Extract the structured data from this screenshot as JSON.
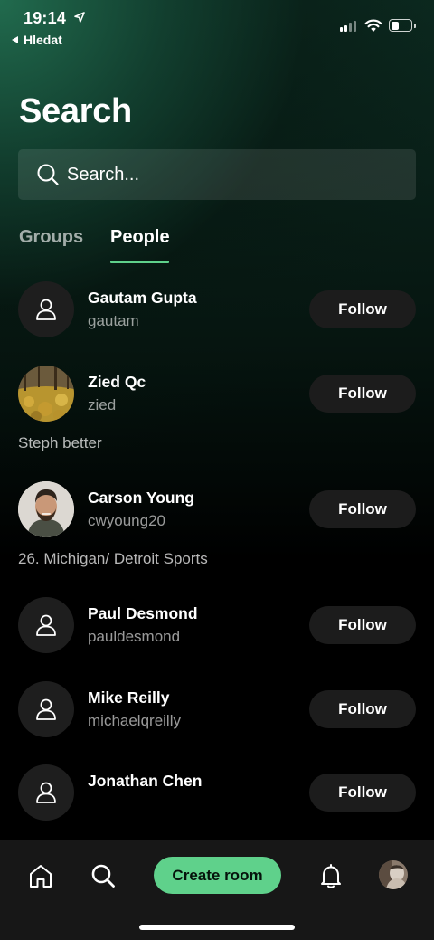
{
  "status_bar": {
    "time": "19:14",
    "back_label": "Hledat"
  },
  "page": {
    "title": "Search"
  },
  "search": {
    "placeholder": "Search..."
  },
  "tabs": [
    {
      "label": "Groups",
      "active": false
    },
    {
      "label": "People",
      "active": true
    }
  ],
  "people": [
    {
      "name": "Gautam Gupta",
      "handle": "gautam",
      "bio": "",
      "avatar": "person-icon",
      "action": "Follow"
    },
    {
      "name": "Zied Qc",
      "handle": "zied",
      "bio": "Steph better",
      "avatar": "photo-leaves",
      "action": "Follow"
    },
    {
      "name": "Carson Young",
      "handle": "cwyoung20",
      "bio": "26. Michigan/ Detroit Sports",
      "avatar": "photo-man",
      "action": "Follow"
    },
    {
      "name": "Paul Desmond",
      "handle": "pauldesmond",
      "bio": "",
      "avatar": "person-icon",
      "action": "Follow"
    },
    {
      "name": "Mike Reilly",
      "handle": "michaelqreilly",
      "bio": "",
      "avatar": "person-icon",
      "action": "Follow"
    },
    {
      "name": "Jonathan Chen",
      "handle": "",
      "bio": "",
      "avatar": "person-icon",
      "action": "Follow"
    }
  ],
  "bottom_nav": {
    "home_icon": "home-icon",
    "search_icon": "search-icon",
    "create_room_label": "Create room",
    "notifications_icon": "bell-icon",
    "profile": "profile-avatar"
  },
  "colors": {
    "accent": "#5fd18b",
    "follow_button_bg": "#1c1c1c",
    "nav_bg": "#171717"
  }
}
